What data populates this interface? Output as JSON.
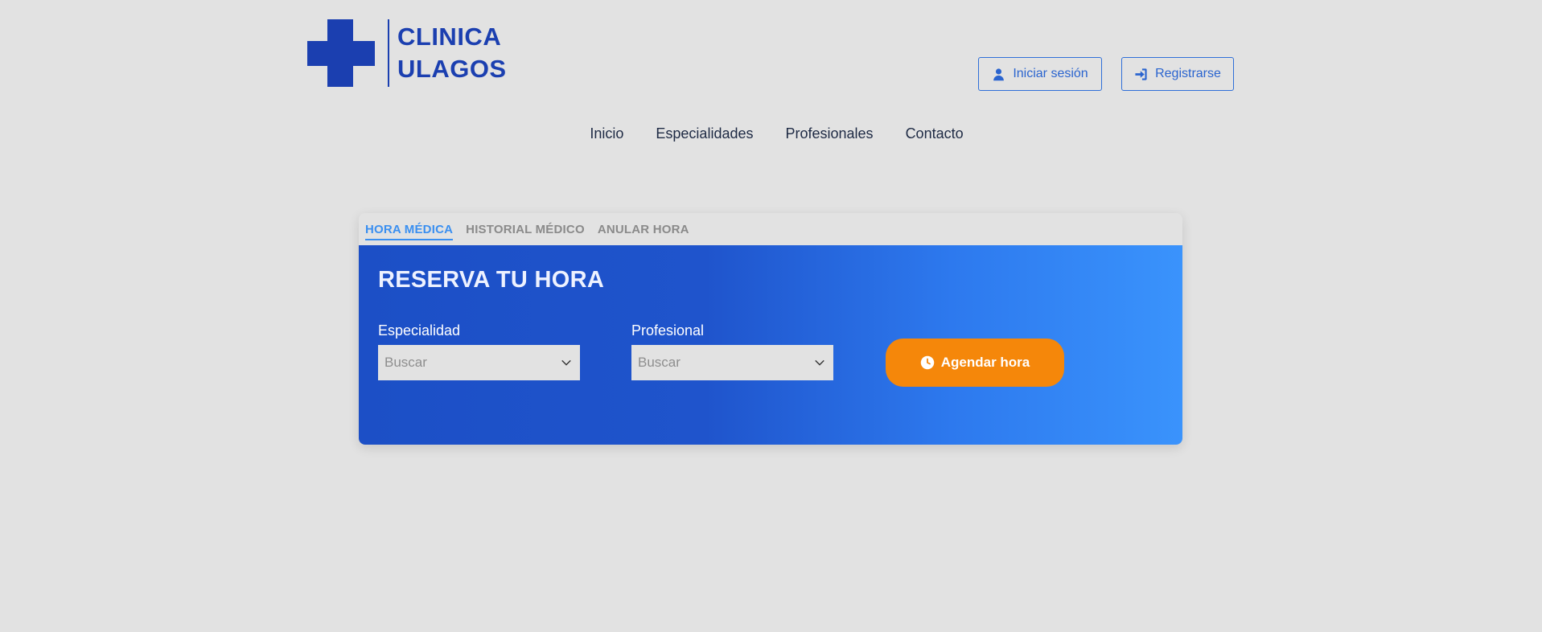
{
  "brand": {
    "line1": "CLINICA",
    "line2": "ULAGOS",
    "color": "#1b3fb0"
  },
  "auth": {
    "login_label": "Iniciar sesión",
    "register_label": "Registrarse"
  },
  "nav": {
    "items": [
      "Inicio",
      "Especialidades",
      "Profesionales",
      "Contacto"
    ]
  },
  "tabs": [
    {
      "label": "HORA MÉDICA",
      "active": true
    },
    {
      "label": "HISTORIAL MÉDICO",
      "active": false
    },
    {
      "label": "ANULAR HORA",
      "active": false
    }
  ],
  "reserva": {
    "title": "RESERVA TU HORA",
    "especialidad": {
      "label": "Especialidad",
      "placeholder": "Buscar"
    },
    "profesional": {
      "label": "Profesional",
      "placeholder": "Buscar"
    },
    "submit_label": "Agendar hora"
  },
  "colors": {
    "accent_orange": "#f5870a",
    "tab_active": "#3a8ff0",
    "background": "#e2e2e2"
  },
  "icons": {
    "login": "user-icon",
    "register": "sign-in-icon",
    "dropdown": "chevron-down-icon",
    "submit": "clock-icon"
  }
}
